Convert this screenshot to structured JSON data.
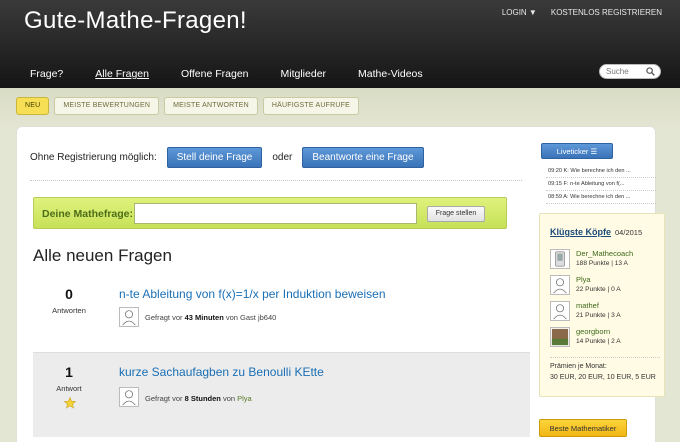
{
  "site": {
    "title": "Gute-Mathe-Fragen!"
  },
  "topbar": {
    "login": "LOGIN ▼",
    "register": "KOSTENLOS REGISTRIEREN"
  },
  "nav": {
    "items": [
      {
        "label": "Frage?"
      },
      {
        "label": "Alle Fragen"
      },
      {
        "label": "Offene Fragen"
      },
      {
        "label": "Mitglieder"
      },
      {
        "label": "Mathe-Videos"
      }
    ],
    "active": "Alle Fragen"
  },
  "search": {
    "placeholder": "Suche"
  },
  "tabs": [
    {
      "label": "NEU"
    },
    {
      "label": "MEISTE BEWERTUNGEN"
    },
    {
      "label": "MEISTE ANTWORTEN"
    },
    {
      "label": "HÄUFIGSTE AUFRUFE"
    }
  ],
  "promo": {
    "text": "Ohne Registrierung möglich:",
    "ask_button": "Stell deine Frage",
    "or": "oder",
    "answer_button": "Beantworte eine Frage"
  },
  "askbar": {
    "label": "Deine Mathefrage:",
    "value": "",
    "button": "Frage stellen"
  },
  "section_title": "Alle neuen Fragen",
  "questions": [
    {
      "count": "0",
      "count_label": "Antworten",
      "title": "n-te Ableitung von f(x)=1/x per Induktion beweisen",
      "meta_prefix": "Gefragt vor ",
      "time": "43 Minuten",
      "meta_mid": " von ",
      "user": "Gast jb640"
    },
    {
      "count": "1",
      "count_label": "Antwort",
      "title": "kurze Sachaufagben zu Benoulli KEtte",
      "meta_prefix": "Gefragt vor ",
      "time": "8 Stunden",
      "meta_mid": " von ",
      "user": "Plya"
    }
  ],
  "liveticker": {
    "button": "Liveticker ☰",
    "items": [
      "09:20 K: Wie berechne ich den ...",
      "09:15 F: n-te Ableitung von f(...",
      "08:59 A: Wie berechne ich den ..."
    ]
  },
  "top_users": {
    "title": "Klügste Köpfe",
    "month": "04/2015",
    "users": [
      {
        "name": "Der_Mathecoach",
        "score": "188 Punkte | 13 A"
      },
      {
        "name": "Plya",
        "score": "22 Punkte | 0 A"
      },
      {
        "name": "mathef",
        "score": "21 Punkte | 3 A"
      },
      {
        "name": "georgborn",
        "score": "14 Punkte | 2 A"
      }
    ],
    "prize_title": "Prämien je Monat:",
    "prizes": "30 EUR, 20 EUR, 10 EUR, 5 EUR"
  },
  "best_button": "Beste Mathematiker",
  "colors": {
    "header": "#262626",
    "accent_blue": "#3a73b8",
    "ask_green": "#c7e158",
    "tab_active": "#f6df55",
    "best_button": "#f0b616"
  }
}
